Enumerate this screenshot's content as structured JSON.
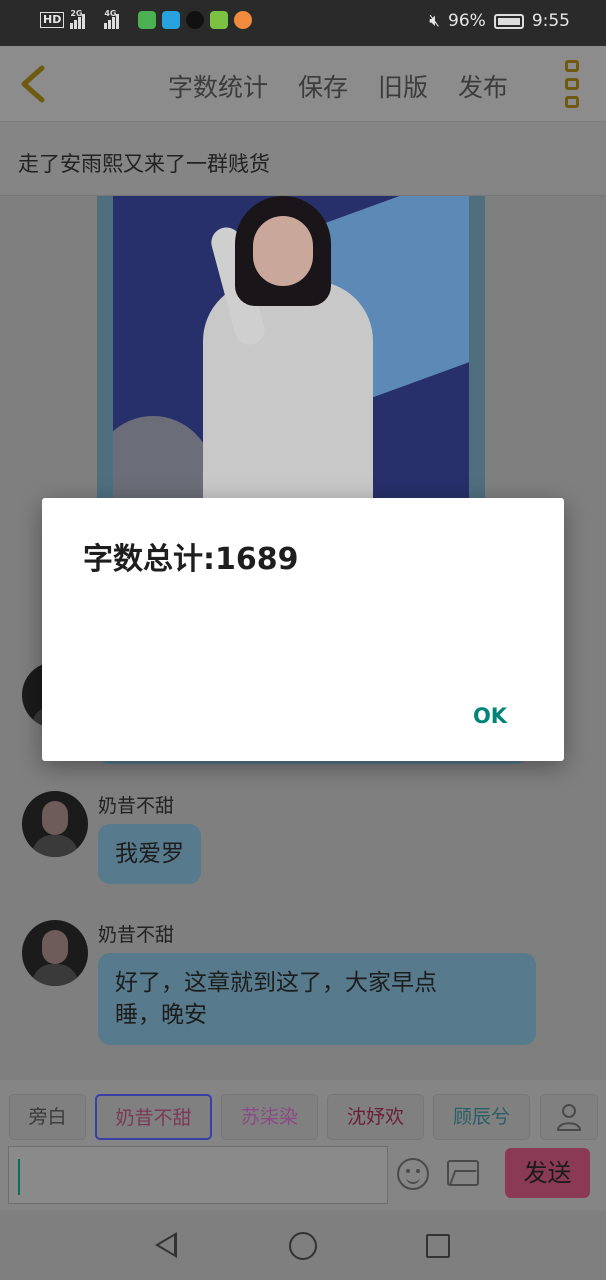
{
  "status_bar": {
    "hd": "HD",
    "net1": "2G",
    "net2": "4G",
    "battery": "96%",
    "time": "9:55"
  },
  "toolbar": {
    "items": [
      "字数统计",
      "保存",
      "旧版",
      "发布"
    ]
  },
  "story": {
    "title": "走了安雨熙又来了一群贱货"
  },
  "messages": [
    {
      "sender": "奶昔不甜",
      "text": "我爱罗"
    },
    {
      "sender": "奶昔不甜",
      "text": "好了，这章就到这了，大家早点\n睡，晚安"
    }
  ],
  "characters": [
    {
      "label": "旁白",
      "color": "#3a3a3a"
    },
    {
      "label": "奶昔不甜",
      "color": "#7a3a55"
    },
    {
      "label": "苏柒染",
      "color": "#8a4a85"
    },
    {
      "label": "沈妤欢",
      "color": "#6a1f3a"
    },
    {
      "label": "顾辰兮",
      "color": "#2c5e66"
    }
  ],
  "input": {
    "placeholder": "",
    "send_label": "发送"
  },
  "dialog": {
    "message": "字数总计:1689",
    "ok_label": "OK"
  },
  "colors": {
    "accent": "#008577",
    "send": "#d85a8a",
    "bubble": "#a9d8f0"
  }
}
